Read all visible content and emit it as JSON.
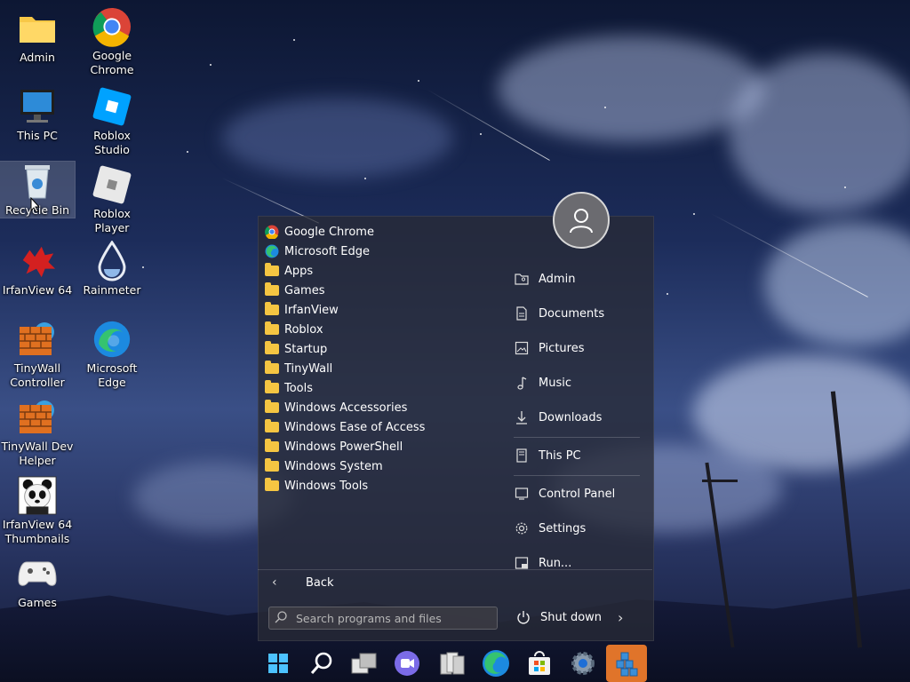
{
  "desktop_icons": [
    {
      "label": "Admin"
    },
    {
      "label": "Google Chrome"
    },
    {
      "label": "This PC"
    },
    {
      "label": "Roblox Studio"
    },
    {
      "label": "Recycle Bin"
    },
    {
      "label": "Roblox Player"
    },
    {
      "label": "IrfanView 64"
    },
    {
      "label": "Rainmeter"
    },
    {
      "label": "TinyWall Controller"
    },
    {
      "label": "Microsoft Edge"
    },
    {
      "label": "TinyWall Dev Helper"
    },
    {
      "label": "IrfanView 64 Thumbnails"
    },
    {
      "label": "Games"
    }
  ],
  "start_menu": {
    "programs": [
      {
        "label": "Google Chrome",
        "icon": "chrome-icon"
      },
      {
        "label": "Microsoft Edge",
        "icon": "edge-icon"
      },
      {
        "label": "Apps",
        "icon": "folder-icon"
      },
      {
        "label": "Games",
        "icon": "folder-icon"
      },
      {
        "label": "IrfanView",
        "icon": "folder-icon"
      },
      {
        "label": "Roblox",
        "icon": "folder-icon"
      },
      {
        "label": "Startup",
        "icon": "folder-icon"
      },
      {
        "label": "TinyWall",
        "icon": "folder-icon"
      },
      {
        "label": "Tools",
        "icon": "folder-icon"
      },
      {
        "label": "Windows Accessories",
        "icon": "folder-icon"
      },
      {
        "label": "Windows Ease of Access",
        "icon": "folder-icon"
      },
      {
        "label": "Windows PowerShell",
        "icon": "folder-icon"
      },
      {
        "label": "Windows System",
        "icon": "folder-icon"
      },
      {
        "label": "Windows Tools",
        "icon": "folder-icon"
      }
    ],
    "back_label": "Back",
    "search_placeholder": "Search programs and files",
    "right_items": [
      {
        "label": "Admin",
        "icon": "user-folder-icon"
      },
      {
        "label": "Documents",
        "icon": "document-icon"
      },
      {
        "label": "Pictures",
        "icon": "picture-icon"
      },
      {
        "label": "Music",
        "icon": "music-icon"
      },
      {
        "label": "Downloads",
        "icon": "download-icon"
      },
      {
        "label": "This PC",
        "icon": "computer-icon"
      },
      {
        "label": "Control Panel",
        "icon": "control-panel-icon"
      },
      {
        "label": "Settings",
        "icon": "gear-icon"
      },
      {
        "label": "Run...",
        "icon": "run-icon"
      }
    ],
    "shutdown_label": "Shut down"
  },
  "taskbar": {
    "items": [
      "start-icon",
      "search-icon",
      "task-view-icon",
      "chat-icon",
      "file-explorer-icon",
      "edge-icon",
      "store-icon",
      "settings-icon",
      "blocks-app-icon"
    ]
  },
  "colors": {
    "accent": "#0078d4",
    "folder": "#f5c542"
  }
}
